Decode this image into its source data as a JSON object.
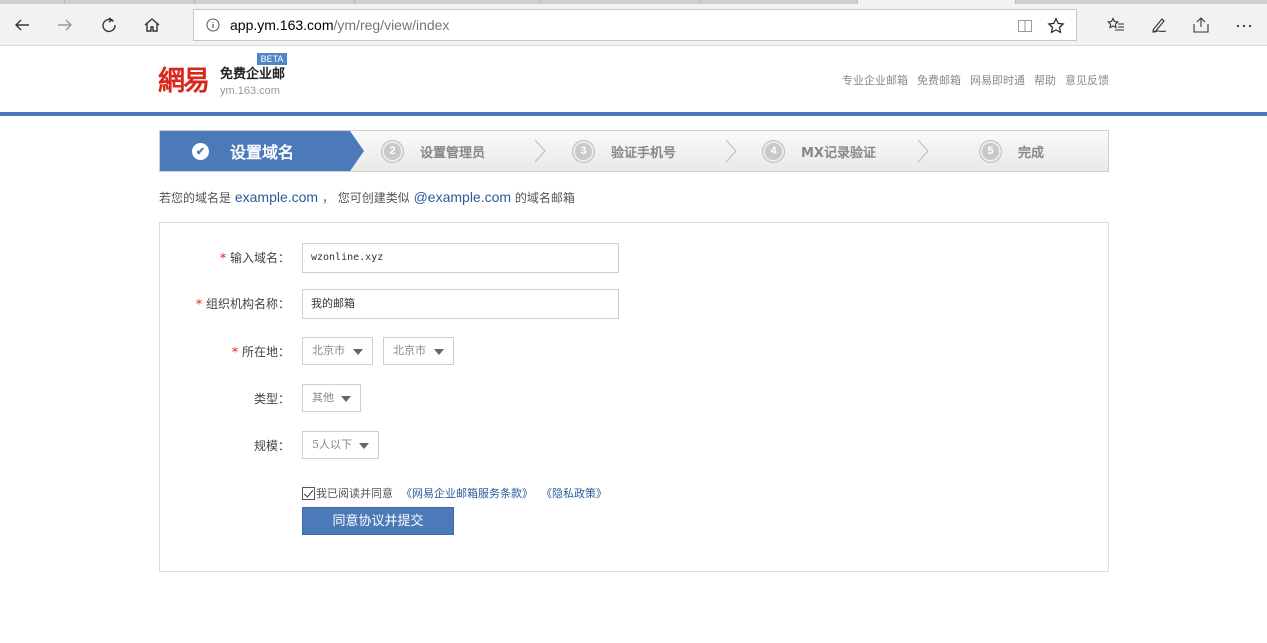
{
  "browser": {
    "url_host": "app.ym.163.com",
    "url_path": "/ym/reg/view/index",
    "back_icon": "arrow-left-icon",
    "forward_icon": "arrow-right-icon",
    "refresh_icon": "refresh-icon",
    "home_icon": "home-icon"
  },
  "header": {
    "logo_text": "網易",
    "logo_title": "免费企业邮",
    "logo_sub": "ym.163.com",
    "beta": "BETA",
    "nav": [
      "专业企业邮箱",
      "免费邮箱",
      "网易即时通",
      "帮助",
      "意见反馈"
    ]
  },
  "steps": [
    {
      "num": "✔",
      "label": "设置域名",
      "active": true
    },
    {
      "num": "2",
      "label": "设置管理员"
    },
    {
      "num": "3",
      "label": "验证手机号"
    },
    {
      "num": "4",
      "label": "MX记录验证"
    },
    {
      "num": "5",
      "label": "完成"
    }
  ],
  "hint": {
    "prefix": "若您的域名是",
    "example_domain": "example.com",
    "middle": "，  您可创建类似",
    "example_email": "@example.com",
    "suffix": "的域名邮箱"
  },
  "form": {
    "required_mark": "*",
    "domain_label": "输入域名：",
    "domain_value": "wzonline.xyz",
    "org_label": "组织机构名称：",
    "org_value": "我的邮箱",
    "location_label": "所在地：",
    "province": "北京市",
    "city": "北京市",
    "type_label": "类型：",
    "type_value": "其他",
    "scale_label": "规模：",
    "scale_value": "5人以下",
    "agree_text": "我已阅读并同意",
    "terms_link": "《网易企业邮箱服务条款》",
    "privacy_link": "《隐私政策》",
    "submit": "同意协议并提交"
  },
  "colors": {
    "accent": "#4c7ab8",
    "brand_red": "#d9281b"
  }
}
